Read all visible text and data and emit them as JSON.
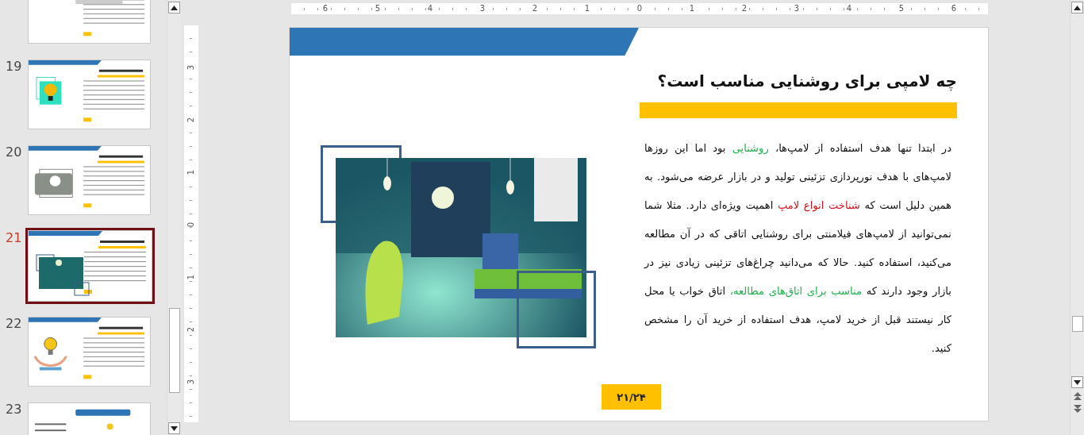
{
  "slide_panel": {
    "thumbnails": [
      {
        "kind": "bulbs",
        "selected": false
      },
      {
        "number": "19",
        "kind": "bulb",
        "selected": false
      },
      {
        "number": "20",
        "kind": "lamp",
        "selected": false
      },
      {
        "number": "21",
        "kind": "room",
        "selected": true
      },
      {
        "number": "22",
        "kind": "hands",
        "selected": false
      },
      {
        "number": "23",
        "kind": "links",
        "selected": false
      }
    ]
  },
  "horizontal_ruler": {
    "labels": [
      "6",
      "5",
      "4",
      "3",
      "2",
      "1",
      "0",
      "1",
      "2",
      "3",
      "4",
      "5",
      "6"
    ]
  },
  "vertical_ruler": {
    "labels": [
      "3",
      "2",
      "1",
      "0",
      "1",
      "2",
      "3"
    ]
  },
  "slide": {
    "title": "چه لامپی برای روشنایی مناسب است؟",
    "paragraph": [
      {
        "text": "در ابتدا تنها هدف استفاده از لامپ‌ها، "
      },
      {
        "text": "روشنایی",
        "color": "#22b14c"
      },
      {
        "text": " بود اما این روزها لامپ‌های با هدف نورپردازی تزئینی تولید و در بازار عرضه می‌شود. به همین دلیل است که "
      },
      {
        "text": "شناخت انواع لامپ",
        "color": "#d0161c"
      },
      {
        "text": " اهمیت ویژه‌ای دارد. مثلا شما نمی‌توانید از لامپ‌های فیلامنتی برای روشنایی اتاقی که در آن مطالعه می‌کنید، استفاده کنید. حالا که می‌دانید چراغ‌های تزئینی زیادی نیز در بازار وجود دارند که "
      },
      {
        "text": "مناسب برای اتاق‌های مطالعه،",
        "color": "#22b14c"
      },
      {
        "text": " اتاق خواب یا محل کار نیستند قبل از خرید لامپ، هدف استفاده از خرید آن را مشخص کنید."
      }
    ],
    "page_number": "۲۱/۲۴"
  }
}
